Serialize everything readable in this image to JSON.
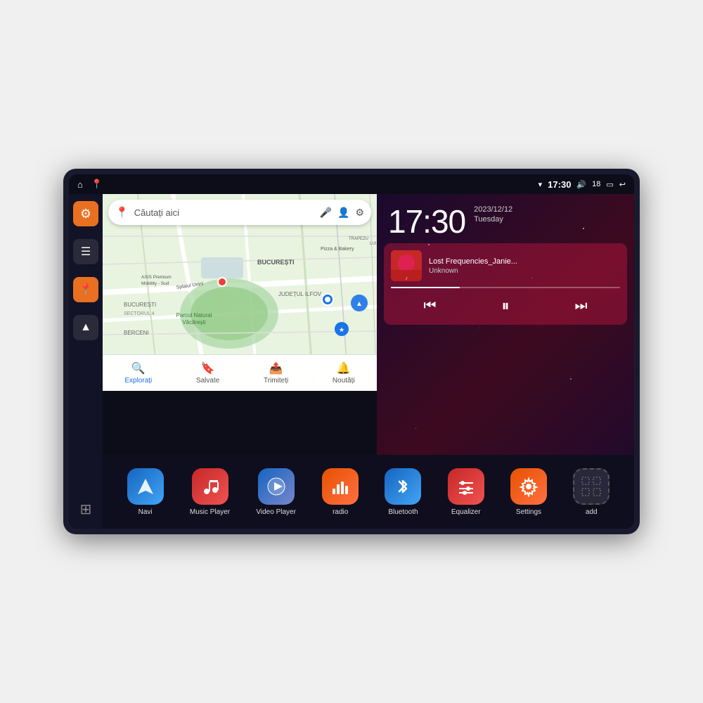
{
  "device": {
    "status_bar": {
      "wifi_icon": "▾",
      "time": "17:30",
      "volume_icon": "🔊",
      "battery_level": "18",
      "battery_icon": "🔋",
      "back_icon": "↩",
      "home_icon": "⌂",
      "maps_icon": "📍"
    },
    "clock": {
      "time": "17:30",
      "date": "2023/12/12",
      "day": "Tuesday"
    },
    "music": {
      "track_name": "Lost Frequencies_Janie...",
      "artist": "Unknown",
      "album_art_emoji": "🎵"
    },
    "map": {
      "search_placeholder": "Căutați aici",
      "locations": [
        "AXIS Premium Mobility - Sud",
        "Pizza & Bakery",
        "Parcul Natural Văcărești",
        "BUCUREȘTI",
        "SECTORUL 4",
        "BERCENI",
        "JUDEȚUL ILFOV",
        "TRAPEZULU"
      ],
      "bottom_tabs": [
        {
          "label": "Explorați",
          "icon": "🔍",
          "active": true
        },
        {
          "label": "Salvate",
          "icon": "🔖",
          "active": false
        },
        {
          "label": "Trimiteți",
          "icon": "📤",
          "active": false
        },
        {
          "label": "Noutăți",
          "icon": "🔔",
          "active": false
        }
      ]
    },
    "apps": [
      {
        "id": "navi",
        "label": "Navi",
        "icon": "◈",
        "color_class": "ic-navi"
      },
      {
        "id": "music-player",
        "label": "Music Player",
        "icon": "♪",
        "color_class": "ic-music"
      },
      {
        "id": "video-player",
        "label": "Video Player",
        "icon": "▶",
        "color_class": "ic-video"
      },
      {
        "id": "radio",
        "label": "radio",
        "icon": "📻",
        "color_class": "ic-radio"
      },
      {
        "id": "bluetooth",
        "label": "Bluetooth",
        "icon": "✦",
        "color_class": "ic-bt"
      },
      {
        "id": "equalizer",
        "label": "Equalizer",
        "icon": "≡",
        "color_class": "ic-eq"
      },
      {
        "id": "settings",
        "label": "Settings",
        "icon": "⚙",
        "color_class": "ic-settings"
      },
      {
        "id": "add",
        "label": "add",
        "icon": "⊞",
        "color_class": "ic-add"
      }
    ],
    "sidebar": {
      "items": [
        {
          "id": "settings",
          "icon": "⚙",
          "color": "orange"
        },
        {
          "id": "files",
          "icon": "☰",
          "color": "dark"
        },
        {
          "id": "maps",
          "icon": "📍",
          "color": "orange"
        },
        {
          "id": "navigation",
          "icon": "▲",
          "color": "dark"
        }
      ]
    }
  }
}
